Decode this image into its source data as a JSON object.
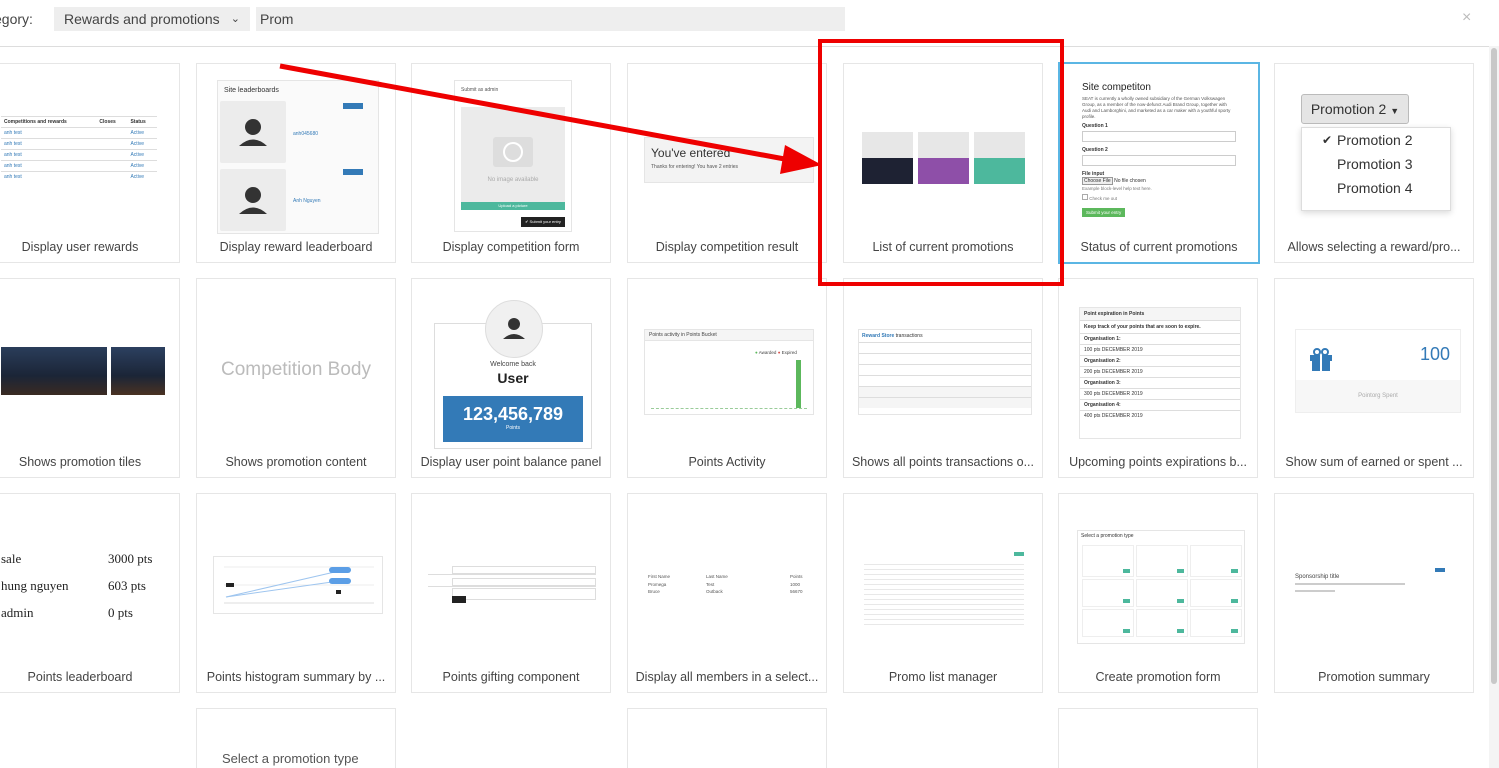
{
  "header": {
    "category_label": "egory:",
    "category_value": "Rewards and promotions",
    "search_value": "Prom",
    "close_symbol": "×"
  },
  "cards": [
    {
      "caption": "Display user rewards"
    },
    {
      "caption": "Display reward leaderboard"
    },
    {
      "caption": "Display competition form"
    },
    {
      "caption": "Display competition result"
    },
    {
      "caption": "List of current promotions"
    },
    {
      "caption": "Status of current promotions"
    },
    {
      "caption": "Allows selecting a reward/pro..."
    },
    {
      "caption": "Shows promotion tiles"
    },
    {
      "caption": "Shows promotion content"
    },
    {
      "caption": "Display user point balance panel"
    },
    {
      "caption": "Points Activity"
    },
    {
      "caption": "Shows all points transactions o..."
    },
    {
      "caption": "Upcoming points expirations b..."
    },
    {
      "caption": "Show sum of earned or spent ..."
    },
    {
      "caption": "Points leaderboard"
    },
    {
      "caption": "Points histogram summary by ..."
    },
    {
      "caption": "Points gifting component"
    },
    {
      "caption": "Display all members in a select..."
    },
    {
      "caption": "Promo list manager"
    },
    {
      "caption": "Create promotion form"
    },
    {
      "caption": "Promotion summary"
    }
  ],
  "thumbs": {
    "rewards_table": {
      "headers": [
        "Competitions and rewards",
        "Closes",
        "Status"
      ],
      "rows": [
        [
          "anh test",
          "",
          "Active"
        ],
        [
          "anh test",
          "",
          "Active"
        ],
        [
          "anh test",
          "",
          "Active"
        ],
        [
          "anh test",
          "",
          "Active"
        ],
        [
          "anh test",
          "",
          "Active"
        ]
      ]
    },
    "leaderboard": {
      "title": "Site leaderboards",
      "user1": "anh045680",
      "user2": "Anh Nguyen"
    },
    "comp_form": {
      "title": "Submit as admin",
      "no_image": "No image available",
      "upload": "Upload a picture",
      "submit": "✔ Submit your entry"
    },
    "comp_result": {
      "title": "You've entered",
      "sub": "Thanks for entering! You have 2 entries"
    },
    "status_form": {
      "title": "Site competiton",
      "body": "SEAT is currently a wholly owned subsidiary of the German Volkswagen Group, as a member of the now-defunct Audi Brand Group, together with Audi and Lamborghini, and marketed as a car maker with a youthful sporty profile.",
      "q1": "Question 1",
      "q2": "Question 2",
      "file_label": "File input",
      "file_btn": "Choose File",
      "file_none": "No file chosen",
      "help": "Example block-level help text here.",
      "check": "Check me out",
      "submit": "Submit your entry"
    },
    "promo_select": {
      "button": "Promotion 2",
      "check": "✔",
      "options": [
        "Promotion 2",
        "Promotion 3",
        "Promotion 4"
      ]
    },
    "competition_body": "Competition Body",
    "balance": {
      "welcome": "Welcome back",
      "user": "User",
      "points": "123,456,789",
      "points_label": "Points"
    },
    "activity": {
      "title": "Points activity in Points Bucket",
      "legend_awarded": "Awarded",
      "legend_expired": "Expired"
    },
    "transactions": {
      "title_bold": "Reward Store",
      "title_rest": " transactions"
    },
    "expirations": {
      "title": "Point expiration in Points",
      "sub": "Keep track of your points that are soon to expire.",
      "items": [
        {
          "org": "Organisation 1:",
          "line": "100 pts  DECEMBER 2019"
        },
        {
          "org": "Organisation 2:",
          "line": "200 pts  DECEMBER 2019"
        },
        {
          "org": "Organisation 3:",
          "line": "300 pts  DECEMBER 2019"
        },
        {
          "org": "Organisation 4:",
          "line": "400 pts  DECEMBER 2019"
        }
      ]
    },
    "sum": {
      "value": "100",
      "label": "Pointorg Spent"
    },
    "points_lb": [
      {
        "name": "sale",
        "pts": "3000 pts"
      },
      {
        "name": "hung nguyen",
        "pts": "603 pts"
      },
      {
        "name": "admin",
        "pts": "0 pts"
      }
    ],
    "members": {
      "headers": [
        "First Name",
        "Last Name",
        "Points"
      ],
      "rows": [
        [
          "Promega",
          "Test",
          "1000"
        ],
        [
          "Bruce",
          "Outback",
          "56670"
        ]
      ]
    },
    "create_promo": {
      "title": "Select a promotion type"
    },
    "promo_summary": {
      "title": "Sponsorship title"
    }
  },
  "partial_card": {
    "text": "Select a promotion type"
  },
  "colors": {
    "highlight": "#e00000",
    "selected_border": "#5bb6e4",
    "balance_blue": "#337ab7",
    "green": "#5cb85c",
    "teal": "#4db89d",
    "purple": "#8e4fa8",
    "dark": "#1e2233"
  }
}
